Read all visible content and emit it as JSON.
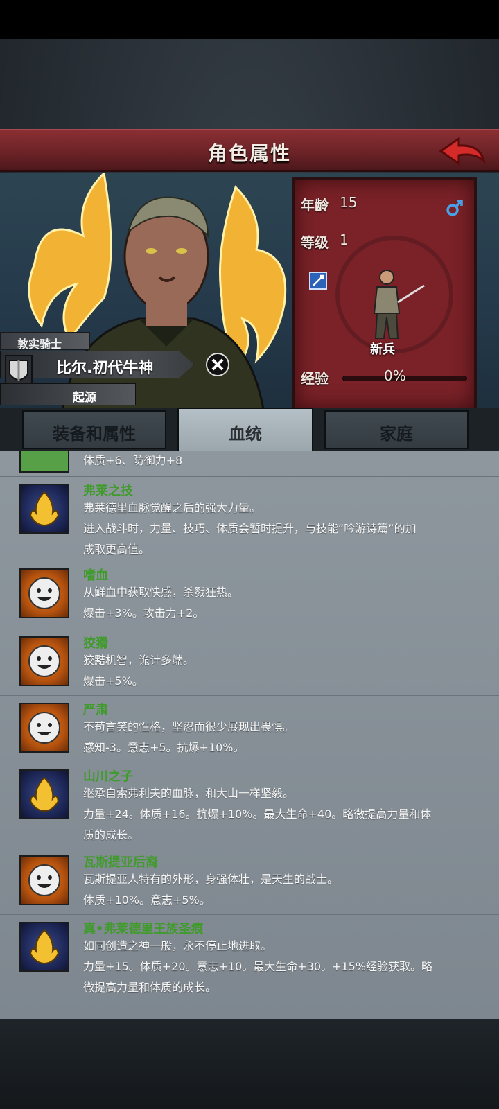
{
  "header": {
    "title": "角色属性"
  },
  "character": {
    "title": "敦实骑士",
    "name": "比尔.初代牛神",
    "origin": "起源"
  },
  "stats": {
    "age_label": "年龄",
    "age_value": "15",
    "level_label": "等级",
    "level_value": "1",
    "class_name": "新兵",
    "exp_label": "经验",
    "exp_value": "0%"
  },
  "tabs": [
    {
      "label": "装备和属性"
    },
    {
      "label": "血统"
    },
    {
      "label": "家庭"
    }
  ],
  "traits": [
    {
      "icon": "partial-green-icon",
      "title": "",
      "desc": [
        "体质+6、防御力+8"
      ]
    },
    {
      "icon": "bloodline-icon",
      "title": "弗莱之技",
      "desc": [
        "弗莱德里血脉觉醒之后的强大力量。",
        "进入战斗时，力量、技巧、体质会暂时提升，与技能“吟游诗篇”的加",
        "成取更高值。"
      ]
    },
    {
      "icon": "smiley-icon",
      "title": "嗜血",
      "desc": [
        "从鲜血中获取快感，杀戮狂热。",
        "爆击+3%。攻击力+2。"
      ]
    },
    {
      "icon": "smiley-icon",
      "title": "狡猾",
      "desc": [
        "狡黠机智，诡计多端。",
        "爆击+5%。"
      ]
    },
    {
      "icon": "smiley-icon",
      "title": "严肃",
      "desc": [
        "不苟言笑的性格，坚忍而很少展现出畏惧。",
        "感知-3。意志+5。抗爆+10%。"
      ]
    },
    {
      "icon": "bloodline-icon",
      "title": "山川之子",
      "desc": [
        "继承自索弗利夫的血脉，和大山一样坚毅。",
        "力量+24。体质+16。抗爆+10%。最大生命+40。略微提高力量和体",
        "质的成长。"
      ]
    },
    {
      "icon": "smiley-icon",
      "title": "瓦斯提亚后裔",
      "desc": [
        "瓦斯提亚人特有的外形，身强体壮，是天生的战士。",
        "体质+10%。意志+5%。"
      ]
    },
    {
      "icon": "bloodline-icon",
      "title": "真•弗莱德里王族圣痕",
      "desc": [
        "如同创造之神一般，永不停止地进取。",
        "力量+15。体质+20。意志+10。最大生命+30。+15%经验获取。略",
        "微提高力量和体质的成长。"
      ]
    }
  ]
}
